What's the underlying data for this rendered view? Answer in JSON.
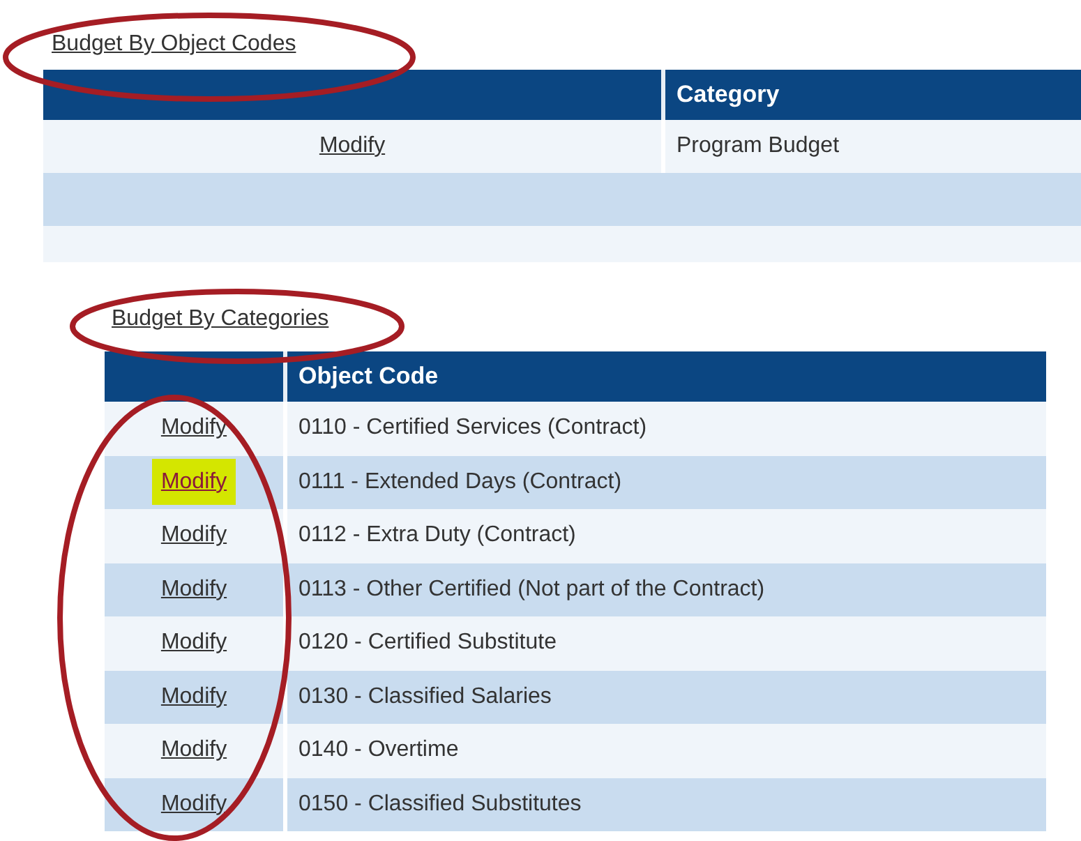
{
  "object_codes_section": {
    "link": "Budget By Object Codes",
    "circled": true,
    "columns": [
      "Category"
    ],
    "rows": [
      {
        "kind": "data",
        "action": "Modify",
        "category": "Program Budget"
      },
      {
        "kind": "empty"
      },
      {
        "kind": "empty"
      }
    ]
  },
  "categories_section": {
    "link": "Budget By Categories",
    "circled": true,
    "action_column_circled": true,
    "columns": [
      "Object Code"
    ],
    "rows": [
      {
        "action": "Modify",
        "highlighted": false,
        "object_code": "0110 - Certified Services (Contract)"
      },
      {
        "action": "Modify",
        "highlighted": true,
        "object_code": "0111 - Extended Days (Contract)"
      },
      {
        "action": "Modify",
        "highlighted": false,
        "object_code": "0112 - Extra Duty (Contract)"
      },
      {
        "action": "Modify",
        "highlighted": false,
        "object_code": "0113 - Other Certified (Not part of the Contract)"
      },
      {
        "action": "Modify",
        "highlighted": false,
        "object_code": "0120 - Certified Substitute"
      },
      {
        "action": "Modify",
        "highlighted": false,
        "object_code": "0130 - Classified Salaries"
      },
      {
        "action": "Modify",
        "highlighted": false,
        "object_code": "0140 - Overtime"
      },
      {
        "action": "Modify",
        "highlighted": false,
        "object_code": "0150 - Classified Substitutes"
      }
    ]
  }
}
